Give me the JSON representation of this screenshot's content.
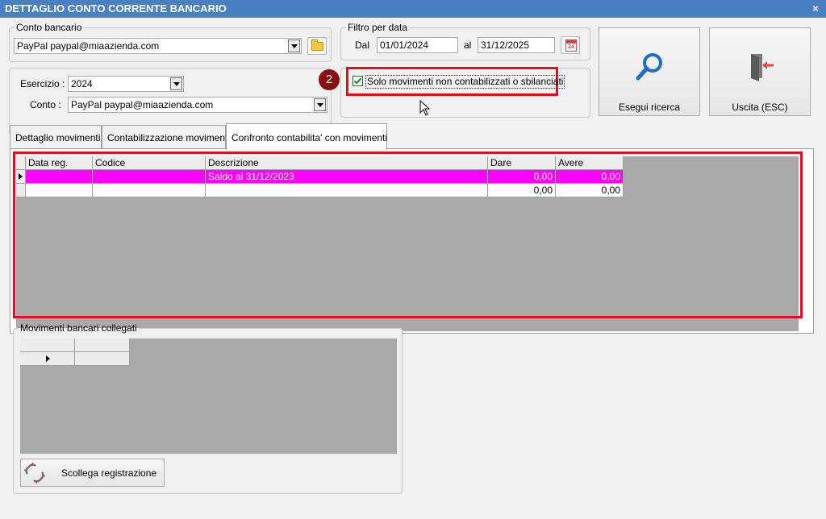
{
  "window": {
    "title": "DETTAGLIO CONTO CORRENTE BANCARIO",
    "close": "×"
  },
  "conto_bancario": {
    "legend": "Conto bancario",
    "value": "PayPal paypal@miaazienda.com"
  },
  "filtro": {
    "legend": "Filtro per data",
    "dal_label": "Dal",
    "dal_value": "01/01/2024",
    "al_label": "al",
    "al_value": "31/12/2025",
    "calendar_day": "24"
  },
  "esercizio": {
    "label": "Esercizio :",
    "value": "2024"
  },
  "conto": {
    "label": "Conto :",
    "value": "PayPal paypal@miaazienda.com"
  },
  "badge": "2",
  "checkbox": {
    "label": "Solo movimenti non contabilizzati o sbilanciati",
    "checked": true
  },
  "buttons": {
    "search": "Esegui ricerca",
    "exit": "Uscita (ESC)"
  },
  "tabs": [
    {
      "label": "Dettaglio movimenti"
    },
    {
      "label": "Contabilizzazione movimenti"
    },
    {
      "label": "Confronto contabilita' con movimenti"
    }
  ],
  "grid": {
    "headers": [
      "Data reg.",
      "Codice",
      "Descrizione",
      "Dare",
      "Avere"
    ],
    "rows": [
      {
        "data_reg": "",
        "codice": "",
        "descrizione": "Saldo al 31/12/2023",
        "dare": "0,00",
        "avere": "0,00"
      },
      {
        "data_reg": "",
        "codice": "",
        "descrizione": "",
        "dare": "0,00",
        "avere": "0,00"
      }
    ]
  },
  "movimenti": {
    "legend": "Movimenti bancari collegati"
  },
  "unlink_button": "Scollega registrazione",
  "colors": {
    "highlight": "#ff00ff",
    "annotation": "#e0101e",
    "badge": "#8b0d12",
    "title_bar": "#4a7fc1"
  }
}
